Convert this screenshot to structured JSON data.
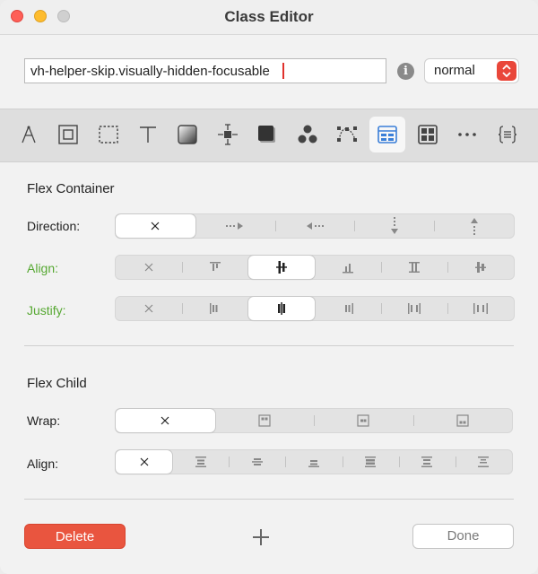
{
  "window": {
    "title": "Class Editor"
  },
  "class_name": {
    "value": "vh-helper-skip.visually-hidden-focusable"
  },
  "info_glyph": "i",
  "state_select": {
    "selected": "normal"
  },
  "toolbar": {
    "icons": [
      "pen-tool-icon",
      "box-icon",
      "dashed-box-icon",
      "text-icon",
      "gradient-icon",
      "spacing-icon",
      "shadow-icon",
      "shapes-icon",
      "path-icon",
      "flex-layout-icon",
      "grid-layout-icon",
      "more-icon",
      "code-icon"
    ],
    "active": "flex-layout-icon"
  },
  "flex_container": {
    "title": "Flex Container",
    "direction": {
      "label": "Direction:",
      "options": [
        "none",
        "row",
        "row-reverse",
        "column",
        "column-reverse"
      ],
      "selected": "none"
    },
    "align": {
      "label": "Align:",
      "options": [
        "none",
        "start",
        "center",
        "end",
        "stretch",
        "baseline"
      ],
      "selected": "center"
    },
    "justify": {
      "label": "Justify:",
      "options": [
        "none",
        "start",
        "center",
        "end",
        "space-between",
        "space-around"
      ],
      "selected": "center"
    }
  },
  "flex_child": {
    "title": "Flex Child",
    "wrap": {
      "label": "Wrap:",
      "options": [
        "none",
        "top-left",
        "center",
        "bottom-right"
      ],
      "selected": "none"
    },
    "align": {
      "label": "Align:",
      "options": [
        "none",
        "start",
        "center",
        "end",
        "stretch",
        "baseline",
        "auto"
      ],
      "selected": "none"
    }
  },
  "footer": {
    "delete_label": "Delete",
    "done_label": "Done"
  },
  "colors": {
    "accent_green": "#56a832",
    "delete_red": "#e9553f",
    "active_tool_blue": "#3a7fd8"
  }
}
